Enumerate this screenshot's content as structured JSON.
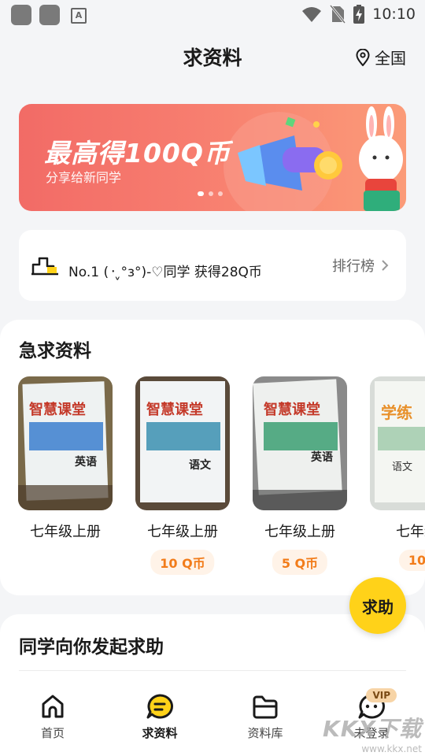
{
  "status_bar": {
    "time": "10:10"
  },
  "header": {
    "title": "求资料",
    "region": "全国"
  },
  "banner": {
    "title": "最高得100Q币",
    "subtitle": "分享给新同学",
    "slides": 3,
    "active_slide": 0,
    "colors": {
      "from": "#f26b66",
      "to": "#fb9b78"
    }
  },
  "ranking": {
    "text": "No.1 (᠂ˬ°з°)-♡同学 获得28Q币",
    "link": "排行榜"
  },
  "urgent": {
    "title": "急求资料",
    "items": [
      {
        "label": "七年级上册",
        "price": "",
        "cover_title": "智慧课堂",
        "cover_subject": "英语"
      },
      {
        "label": "七年级上册",
        "price": "10 Q币",
        "cover_title": "智慧课堂",
        "cover_subject": "语文"
      },
      {
        "label": "七年级上册",
        "price": "5 Q币",
        "cover_title": "智慧课堂",
        "cover_subject": "英语"
      },
      {
        "label": "七年级",
        "price": "10",
        "cover_title": "学练",
        "cover_subject": "语文"
      }
    ]
  },
  "help_button": {
    "label": "求助",
    "color": "#ffd219"
  },
  "ask_section": {
    "title": "同学向你发起求助"
  },
  "bottom_nav": {
    "items": [
      {
        "label": "首页",
        "icon": "home-icon"
      },
      {
        "label": "求资料",
        "icon": "chat-bubble-icon",
        "active": true
      },
      {
        "label": "资料库",
        "icon": "folder-icon"
      },
      {
        "label": "未登录",
        "icon": "profile-icon",
        "badge": "VIP"
      }
    ]
  },
  "watermark": {
    "brand": "KKX下载",
    "url": "www.kkx.net"
  }
}
